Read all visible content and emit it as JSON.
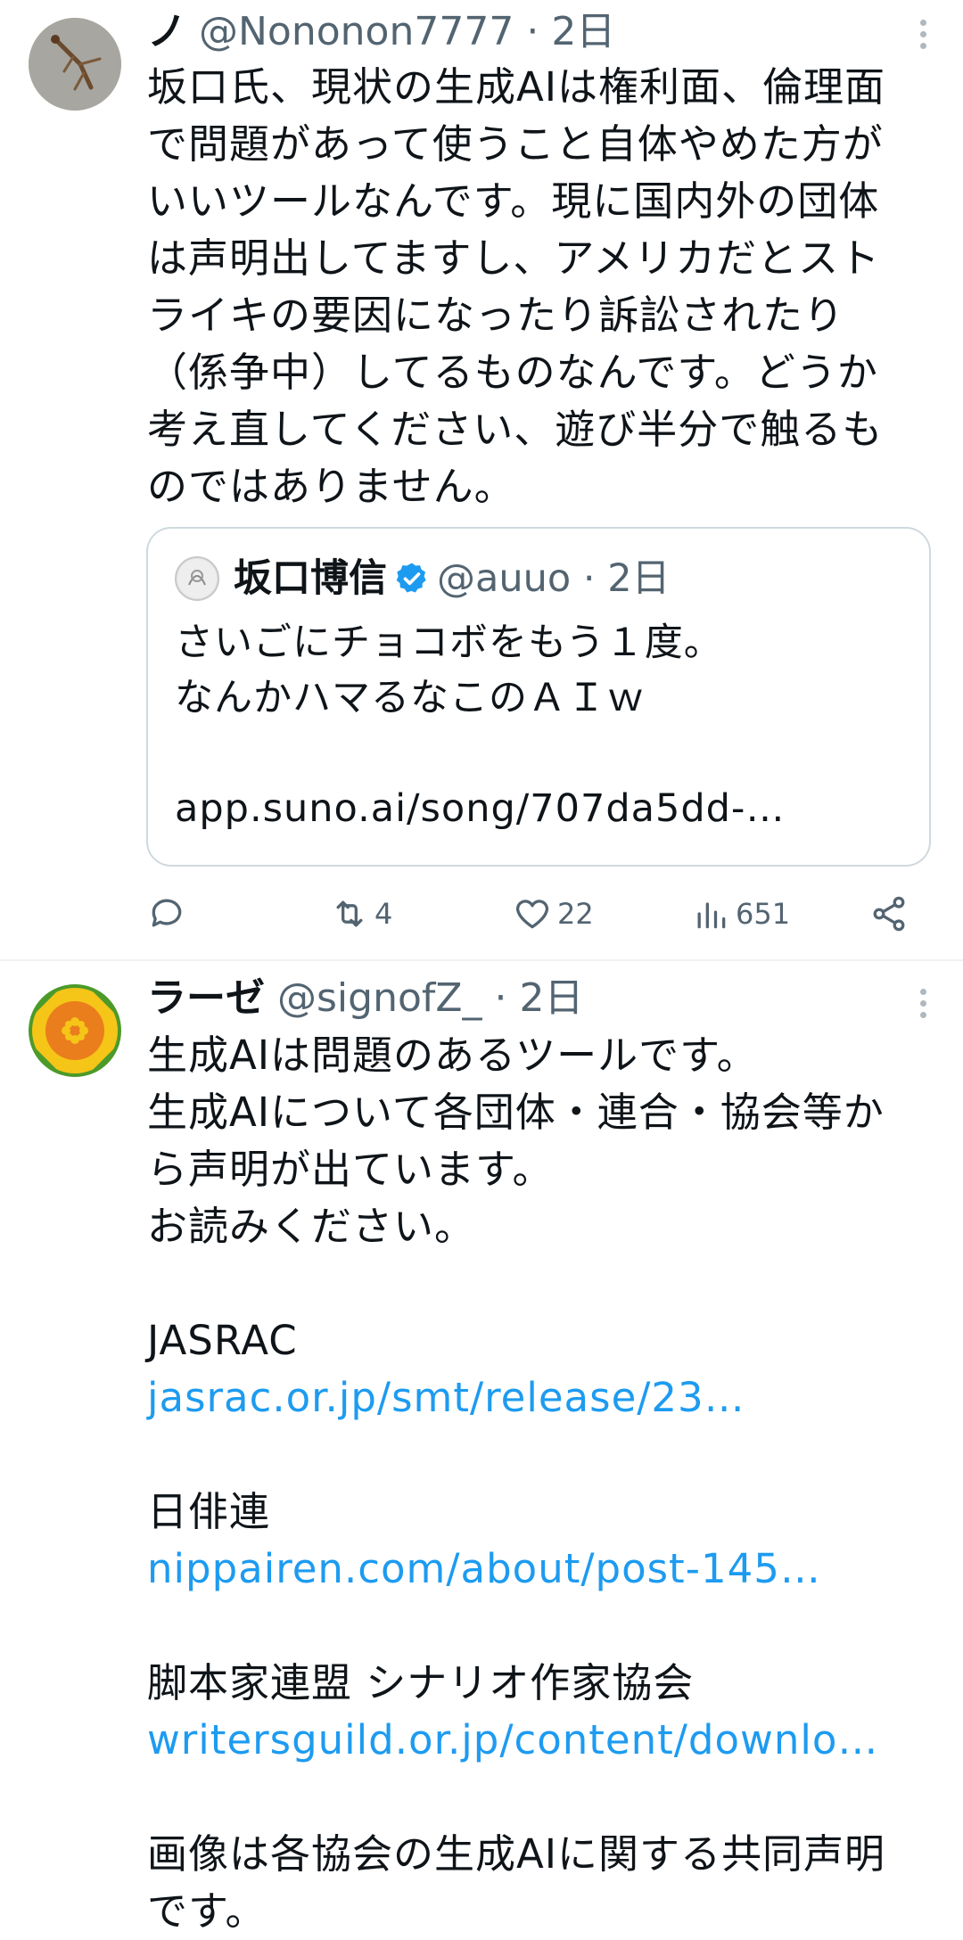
{
  "tweet1": {
    "name": "ノ",
    "handle": "@Nononon7777",
    "sep": "·",
    "time": "2日",
    "lines": [
      "坂口氏、現状の生成AIは権利面、倫理面",
      "で問題があって使うこと自体やめた方が",
      "いいツールなんです。現に国内外の団体",
      "は声明出してますし、アメリカだとスト",
      "ライキの要因になったり訴訟されたり",
      "（係争中）してるものなんです。どうか",
      "考え直してください、遊び半分で触るも",
      "のではありません。"
    ],
    "quote": {
      "name": "坂口博信",
      "handle": "@auuo",
      "sep": "·",
      "time": "2日",
      "lines": [
        "さいごにチョコボをもう１度。",
        "なんかハマるなこのＡＩｗ",
        "",
        "app.suno.ai/song/707da5dd-…"
      ]
    },
    "actions": {
      "reply_count": "",
      "retweet_count": "4",
      "like_count": "22",
      "views_count": "651"
    }
  },
  "tweet2": {
    "name": "ラーゼ",
    "handle": "@signofZ_",
    "sep": "·",
    "time": "2日",
    "lines": [
      {
        "text": "生成AIは問題のあるツールです。",
        "link": false
      },
      {
        "text": "生成AIについて各団体・連合・協会等か",
        "link": false
      },
      {
        "text": "ら声明が出ています。",
        "link": false
      },
      {
        "text": "お読みください。",
        "link": false
      },
      {
        "text": "",
        "link": false
      },
      {
        "text": "JASRAC",
        "link": false
      },
      {
        "text": "jasrac.or.jp/smt/release/23…",
        "link": true
      },
      {
        "text": "",
        "link": false
      },
      {
        "text": "日俳連",
        "link": false
      },
      {
        "text": "nippairen.com/about/post-145…",
        "link": true
      },
      {
        "text": "",
        "link": false
      },
      {
        "text": "脚本家連盟 シナリオ作家協会",
        "link": false
      },
      {
        "text": "writersguild.or.jp/content/downlo…",
        "link": true
      },
      {
        "text": "",
        "link": false
      },
      {
        "text": "画像は各協会の生成AIに関する共同声明",
        "link": false
      },
      {
        "text": "です。",
        "link": false
      }
    ]
  },
  "colors": {
    "link": "#1d9bf0",
    "secondary_text": "#536471",
    "verified": "#1d9bf0",
    "border": "#cfd9de"
  },
  "icons": [
    "reply-icon",
    "retweet-icon",
    "like-icon",
    "views-icon",
    "share-icon",
    "more-icon",
    "verified-icon"
  ]
}
